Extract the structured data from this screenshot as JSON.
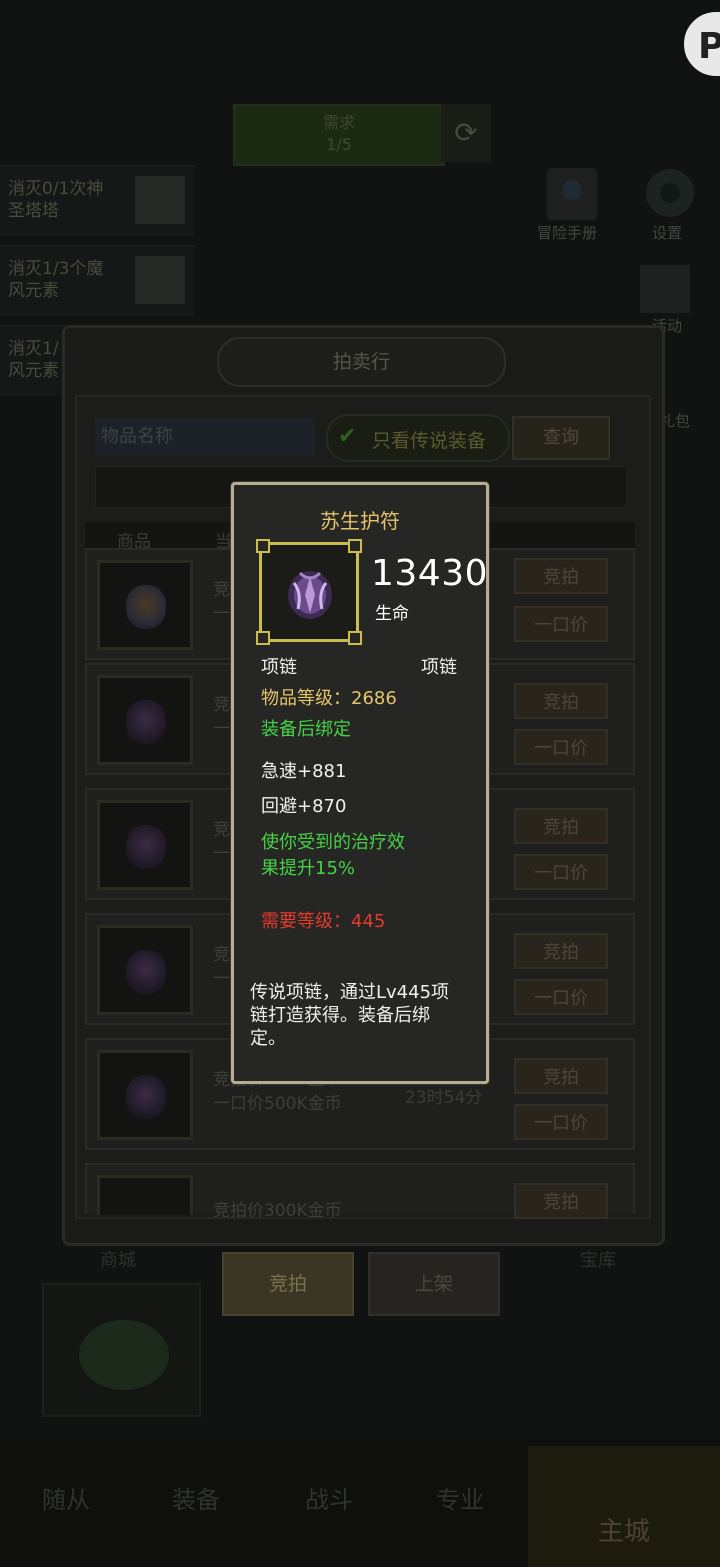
{
  "background": {
    "top_banner_lines": [
      "需求",
      "1/5"
    ],
    "quests": [
      {
        "line1": "消灭0/1次神",
        "line2": "圣塔塔"
      },
      {
        "line1": "消灭1/3个魔",
        "line2": "风元素"
      },
      {
        "line1": "消灭1/",
        "line2": "风元素"
      }
    ],
    "side_icons": [
      {
        "label": "冒险手册",
        "icon": "book-icon"
      },
      {
        "label": "设置",
        "icon": "gear-icon"
      },
      {
        "label": "活动",
        "icon": "calendar-icon"
      },
      {
        "label": "礼包",
        "icon": "gift-icon"
      }
    ],
    "shop_label": "商城",
    "vault_label": "宝库",
    "nav": [
      "随从",
      "装备",
      "战斗",
      "专业",
      "主城"
    ]
  },
  "auction": {
    "title": "拍卖行",
    "search_placeholder": "物品名称",
    "legend_only_label": "只看传说装备",
    "query_label": "查询",
    "columns": [
      "商品",
      "当"
    ],
    "rows": [
      {
        "price_line1": "竞",
        "price_line2": "一",
        "time": ""
      },
      {
        "price_line1": "竞",
        "price_line2": "一",
        "time": ""
      },
      {
        "price_line1": "竞拍",
        "price_line2": "一口",
        "time": ""
      },
      {
        "price_line1": "竞拍",
        "price_line2": "一口",
        "time": ""
      },
      {
        "price_line1": "竞拍价300K金币",
        "price_line2": "一口价500K金币",
        "time": "23时54分"
      },
      {
        "price_line1": "竞拍价300K金币",
        "price_line2": "",
        "time": ""
      }
    ],
    "bid_label": "竞拍",
    "buyout_label": "一口价",
    "tabs": {
      "bid": "竞拍",
      "list": "上架"
    }
  },
  "tooltip": {
    "name": "苏生护符",
    "stat_value": "13430",
    "stat_label": "生命",
    "slot_left": "项链",
    "slot_right": "项链",
    "item_level": "物品等级：2686",
    "bind": "装备后绑定",
    "stats": [
      "急速+881",
      "回避+870"
    ],
    "effect_line1": "使你受到的治疗效",
    "effect_line2": "果提升15%",
    "required_level": "需要等级：445",
    "desc_line1": "传说项链，通过Lv445项",
    "desc_line2": "链打造获得。装备后绑",
    "desc_line3": "定。",
    "colors": {
      "name": "#e4c56a",
      "green": "#46d246",
      "red": "#e23a2c",
      "frame": "#c9bd4f"
    }
  }
}
